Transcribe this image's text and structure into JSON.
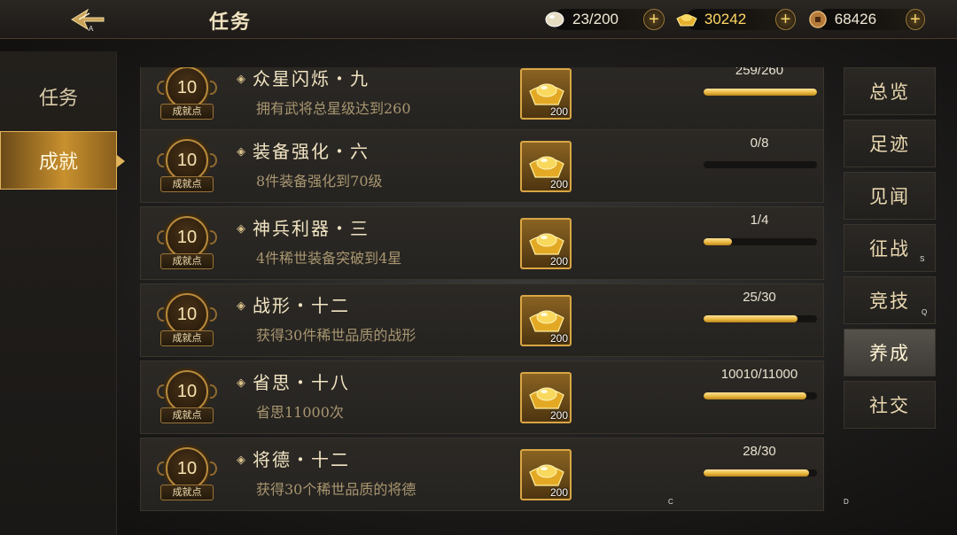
{
  "header": {
    "title": "任务",
    "resources": [
      {
        "name": "stamina",
        "value": "23/200",
        "icon": "egg-icon"
      },
      {
        "name": "gold-ingot",
        "value": "30242",
        "icon": "gold-ingot-icon"
      },
      {
        "name": "copper-coin",
        "value": "68426",
        "icon": "coin-icon"
      }
    ]
  },
  "left_nav": {
    "tabs": [
      {
        "label": "任务",
        "active": false
      },
      {
        "label": "成就",
        "active": true
      }
    ]
  },
  "tasks": [
    {
      "points": "10",
      "points_label": "成就点",
      "title": "众星闪烁・九",
      "desc": "拥有武将总星级达到260",
      "reward_qty": "200",
      "progress_text": "259/260",
      "progress": 0.996
    },
    {
      "points": "10",
      "points_label": "成就点",
      "title": "装备强化・六",
      "desc": "8件装备强化到70级",
      "reward_qty": "200",
      "progress_text": "0/8",
      "progress": 0.0
    },
    {
      "points": "10",
      "points_label": "成就点",
      "title": "神兵利器・三",
      "desc": "4件稀世装备突破到4星",
      "reward_qty": "200",
      "progress_text": "1/4",
      "progress": 0.25
    },
    {
      "points": "10",
      "points_label": "成就点",
      "title": "战形・十二",
      "desc": "获得30件稀世品质的战形",
      "reward_qty": "200",
      "progress_text": "25/30",
      "progress": 0.833
    },
    {
      "points": "10",
      "points_label": "成就点",
      "title": "省思・十八",
      "desc": "省思11000次",
      "reward_qty": "200",
      "progress_text": "10010/11000",
      "progress": 0.91
    },
    {
      "points": "10",
      "points_label": "成就点",
      "title": "将德・十二",
      "desc": "获得30个稀世品质的将德",
      "reward_qty": "200",
      "progress_text": "28/30",
      "progress": 0.933
    }
  ],
  "right_nav": {
    "tabs": [
      {
        "label": "总览",
        "active": false
      },
      {
        "label": "足迹",
        "active": false
      },
      {
        "label": "见闻",
        "active": false
      },
      {
        "label": "征战",
        "active": false
      },
      {
        "label": "竞技",
        "active": false
      },
      {
        "label": "养成",
        "active": true
      },
      {
        "label": "社交",
        "active": false
      }
    ]
  },
  "overlay_marks": [
    "A",
    "S",
    "Q",
    "C",
    "D"
  ],
  "colors": {
    "accent_gold": "#e7b43a",
    "active_tab": "#c8902e",
    "text_light": "#f1e4c2",
    "text_dim": "#a89670"
  }
}
